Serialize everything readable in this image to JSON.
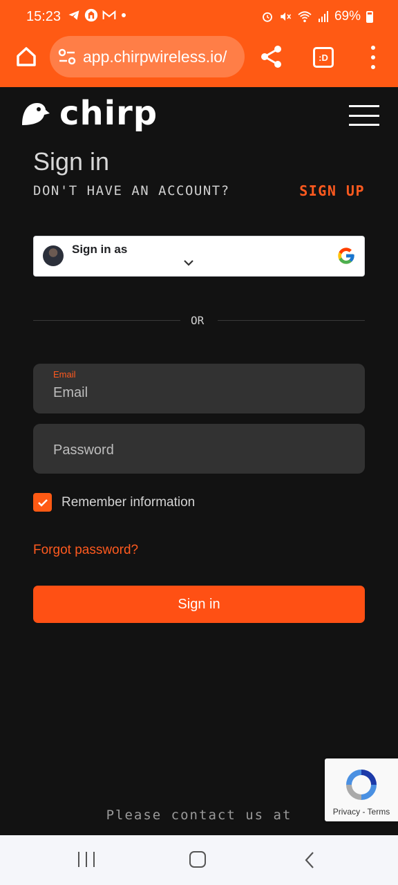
{
  "status_bar": {
    "time": "15:23",
    "battery": "69%",
    "left_icons": [
      "telegram-icon",
      "app-icon",
      "gmail-icon",
      "dot-icon"
    ],
    "right_icons": [
      "alarm-icon",
      "mute-icon",
      "wifi-icon",
      "signal-icon",
      "battery-icon"
    ]
  },
  "browser": {
    "url": "app.chirpwireless.io/",
    "tab_label": ":D"
  },
  "site": {
    "logo_text": "chirp"
  },
  "auth": {
    "title": "Sign in",
    "no_account_text": "DON'T HAVE AN ACCOUNT?",
    "signup_link": "SIGN UP",
    "google_label": "Sign in as",
    "or_text": "OR",
    "email_label": "Email",
    "email_placeholder": "Email",
    "password_placeholder": "Password",
    "remember_label": "Remember information",
    "remember_checked": true,
    "forgot_link": "Forgot password?",
    "signin_button": "Sign in"
  },
  "footer": {
    "contact_text": "Please contact us at"
  },
  "recaptcha": {
    "links": "Privacy - Terms"
  },
  "colors": {
    "accent": "#ff5a14",
    "background": "#121212",
    "field": "#323232"
  }
}
